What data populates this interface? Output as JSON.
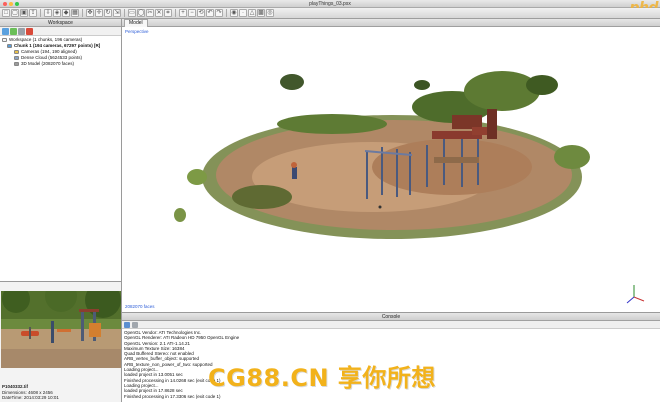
{
  "window": {
    "title": "playThings_03.psx",
    "traffic_lights": [
      "#fc605c",
      "#fdbc40",
      "#34c84a"
    ]
  },
  "brand": {
    "logo_text": "phd"
  },
  "toolbar": {
    "icons": [
      "new-file-icon",
      "open-file-icon",
      "save-icon",
      "import-icon",
      "export-icon",
      "align-icon",
      "mesh-icon",
      "texture-icon",
      "navigate-icon",
      "move-icon",
      "rotate-icon",
      "scale-icon",
      "select-rectangle-icon",
      "select-circle-icon",
      "cut-icon",
      "delete-icon",
      "crop-icon",
      "zoom-in-icon",
      "zoom-out-icon",
      "reset-view-icon",
      "rotate-left-icon",
      "rotate-right-icon",
      "show-cameras-icon",
      "show-points-icon",
      "show-model-icon",
      "show-texture-icon",
      "toggle-trackball-icon"
    ]
  },
  "workspace": {
    "header": "Workspace",
    "tree": [
      {
        "label": "Workspace (1 chunks, 196 cameras)",
        "icon": "workspace-icon",
        "bold": false
      },
      {
        "label": "Chunk 1 (194 cameras, 67297 points) [R]",
        "icon": "chunk-icon",
        "bold": true
      },
      {
        "label": "Cameras (194, 190 aligned)",
        "icon": "cameras-icon",
        "bold": false
      },
      {
        "label": "Dense Cloud (5624533 points)",
        "icon": "dense-cloud-icon",
        "bold": false
      },
      {
        "label": "3D Model (2082070 faces)",
        "icon": "model-icon",
        "bold": false
      }
    ]
  },
  "photo": {
    "filename": "P1040332.tif",
    "dimensions": "Dimensions: 4608 x 2456",
    "datetime": "DateTime: 2014:03:29 10:01"
  },
  "model": {
    "tab_label": "Model",
    "viewport_label": "Perspective",
    "stats": "2082070 faces"
  },
  "console": {
    "header": "Console",
    "lines": [
      "OpenGL Vendor: ATI Technologies Inc.",
      "OpenGL Renderer: ATI Radeon HD 7950 OpenGL Engine",
      "OpenGL Version: 2.1 ATI-1.14.21",
      "Maximum Texture Size: 16384",
      "Quad Buffered Stereo: not enabled",
      "ARB_vertex_buffer_object: supported",
      "ARB_texture_non_power_of_two: supported",
      "Loading project...",
      "loaded project in 13.0051 sec",
      "Finished processing in 14.0268 sec (exit code 1)",
      "Loading project...",
      "loaded project in 17.8628 sec",
      "Finished processing in 17.3306 sec (exit code 1)"
    ]
  },
  "site_watermark": "CG88.CN 享你所想"
}
